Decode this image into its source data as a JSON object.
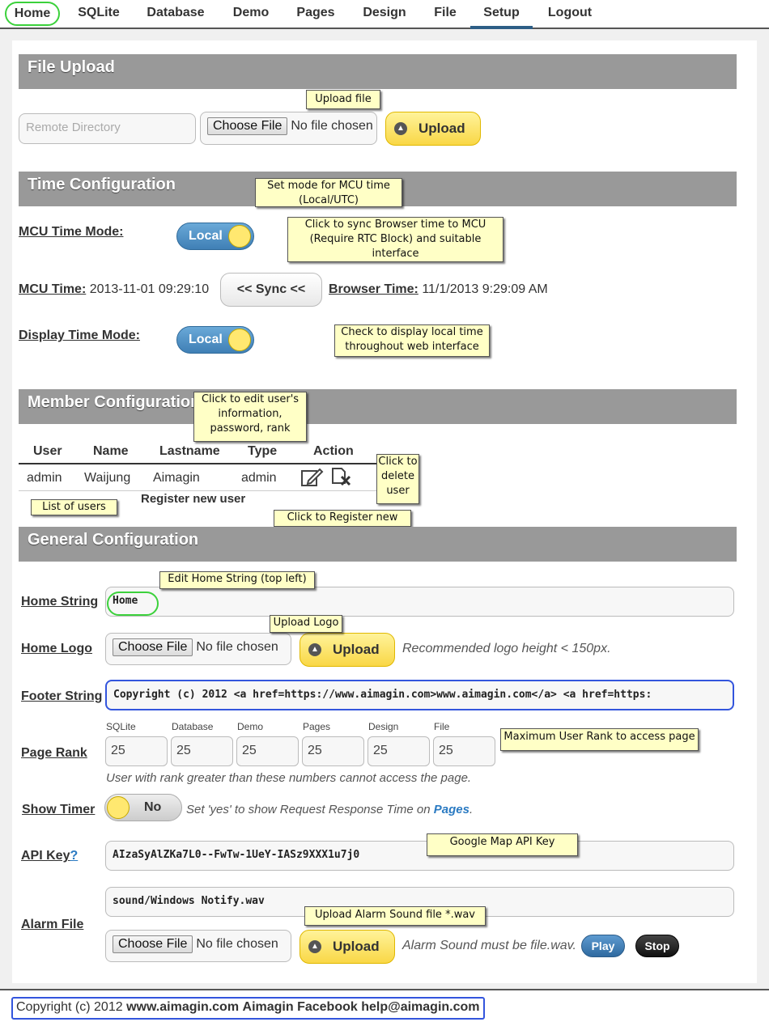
{
  "nav": {
    "items": [
      "Home",
      "SQLite",
      "Database",
      "Demo",
      "Pages",
      "Design",
      "File",
      "Setup",
      "Logout"
    ],
    "active": "Setup"
  },
  "file_upload": {
    "title": "File Upload",
    "remote_dir_placeholder": "Remote Directory",
    "choose_label": "Choose File",
    "no_file": "No file chosen",
    "upload_label": "Upload",
    "callout": "Upload file"
  },
  "time_config": {
    "title": "Time Configuration",
    "mcu_time_mode_label": "MCU Time Mode:",
    "mcu_time_mode_value": "Local",
    "mcu_time_label": "MCU Time:",
    "mcu_time_value": "2013-11-01 09:29:10",
    "sync_label": "<< Sync <<",
    "browser_time_label": "Browser Time:",
    "browser_time_value": "11/1/2013 9:29:09 AM",
    "display_time_mode_label": "Display Time Mode:",
    "display_time_mode_value": "Local",
    "callout_mode": "Set mode for MCU time (Local/UTC)",
    "callout_sync": "Click to sync Browser time to MCU (Require RTC Block) and suitable interface",
    "callout_display": "Check to display local time throughout web interface"
  },
  "member_config": {
    "title": "Member Configuration",
    "headers": [
      "User",
      "Name",
      "Lastname",
      "Type",
      "Action"
    ],
    "rows": [
      {
        "user": "admin",
        "name": "Waijung",
        "lastname": "Aimagin",
        "type": "admin"
      }
    ],
    "register_label": "Register new user",
    "callout_edit": "Click to edit user's information, password, rank",
    "callout_delete": "Click to delete user",
    "callout_list": "List of users",
    "callout_register": "Click to Register new"
  },
  "general_config": {
    "title": "General Configuration",
    "home_string_label": "Home String",
    "home_string_value": "Home",
    "callout_home": "Edit Home String (top left)",
    "home_logo_label": "Home Logo",
    "callout_logo": "Upload Logo",
    "logo_hint": "Recommended logo height < 150px.",
    "footer_string_label": "Footer String",
    "footer_string_value": "Copyright (c) 2012 <a href=https://www.aimagin.com>www.aimagin.com</a> <a href=https:",
    "page_rank_label": "Page Rank",
    "page_rank_cols": [
      "SQLite",
      "Database",
      "Demo",
      "Pages",
      "Design",
      "File"
    ],
    "page_rank_values": [
      "25",
      "25",
      "25",
      "25",
      "25",
      "25"
    ],
    "callout_rank": "Maximum User Rank to access page",
    "rank_hint": "User with rank greater than these numbers cannot access the page.",
    "show_timer_label": "Show Timer",
    "show_timer_value": "No",
    "timer_hint_pre": "Set 'yes' to show Request Response Time on ",
    "timer_hint_link": "Pages",
    "timer_hint_post": ".",
    "api_key_label": "API Key",
    "api_key_q": "?",
    "api_key_value": "AIzaSyAlZKa7L0--FwTw-1UeY-IASz9XXX1u7j0",
    "callout_api": "Google Map API Key",
    "alarm_file_label": "Alarm File",
    "alarm_file_value": "sound/Windows Notify.wav",
    "callout_alarm": "Upload Alarm Sound file *.wav",
    "alarm_hint": "Alarm Sound must be file.wav.",
    "play_label": "Play",
    "stop_label": "Stop"
  },
  "footer": {
    "pre": "Copyright (c) 2012 ",
    "link1": "www.aimagin.com",
    "link2": "Aimagin Facebook",
    "email": "help@aimagin.com"
  },
  "colors": {
    "accent": "#2d5e86",
    "section_bg": "#999999",
    "callout_bg": "#ffffc6",
    "upload_bg": "#f9d746",
    "highlight_green": "#3bd13b",
    "highlight_blue": "#3355dd"
  }
}
